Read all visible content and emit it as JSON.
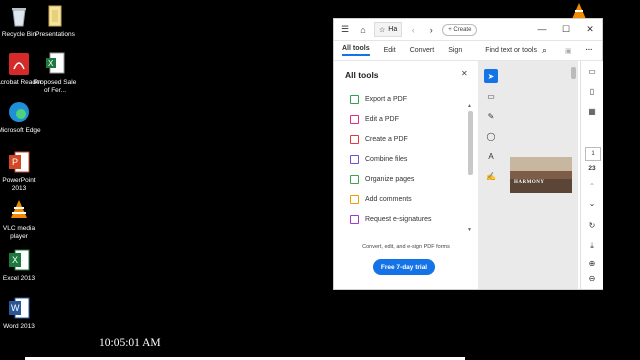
{
  "desktop": {
    "icons": [
      {
        "name": "recycle-bin",
        "label": "Recycle Bin"
      },
      {
        "name": "presentations",
        "label": "Presentations"
      },
      {
        "name": "acrobat-reader",
        "label": "Acrobat Reader"
      },
      {
        "name": "proposed-sale",
        "label": "Proposed Sale of Fer..."
      },
      {
        "name": "microsoft-edge",
        "label": "Microsoft Edge"
      },
      {
        "name": "powerpoint-2013",
        "label": "PowerPoint 2013"
      },
      {
        "name": "vlc-media-player",
        "label": "VLC media player"
      },
      {
        "name": "excel-2013",
        "label": "Excel 2013"
      },
      {
        "name": "word-2013",
        "label": "Word 2013"
      }
    ]
  },
  "clock": {
    "time": "10:05:01 AM"
  },
  "acrobat": {
    "tab_label": "Ha",
    "create_label": "+ Create",
    "menu": {
      "all_tools": "All tools",
      "edit": "Edit",
      "convert": "Convert",
      "sign": "Sign"
    },
    "search_label": "Find text or tools",
    "panel": {
      "title": "All tools",
      "tools": [
        {
          "label": "Export a PDF",
          "color": "#2ea44f"
        },
        {
          "label": "Edit a PDF",
          "color": "#e0307a"
        },
        {
          "label": "Create a PDF",
          "color": "#e03c3c"
        },
        {
          "label": "Combine files",
          "color": "#6b4fd6"
        },
        {
          "label": "Organize pages",
          "color": "#3aa845"
        },
        {
          "label": "Add comments",
          "color": "#e8a400"
        },
        {
          "label": "Request e-signatures",
          "color": "#a13cc9"
        }
      ],
      "promo_text": "Convert, edit, and e-sign PDF forms",
      "trial_button": "Free 7-day trial"
    },
    "document": {
      "thumbnail_title": "HARMONY"
    },
    "page": {
      "current": "1",
      "total": "23"
    },
    "accent": "#1473e6"
  }
}
